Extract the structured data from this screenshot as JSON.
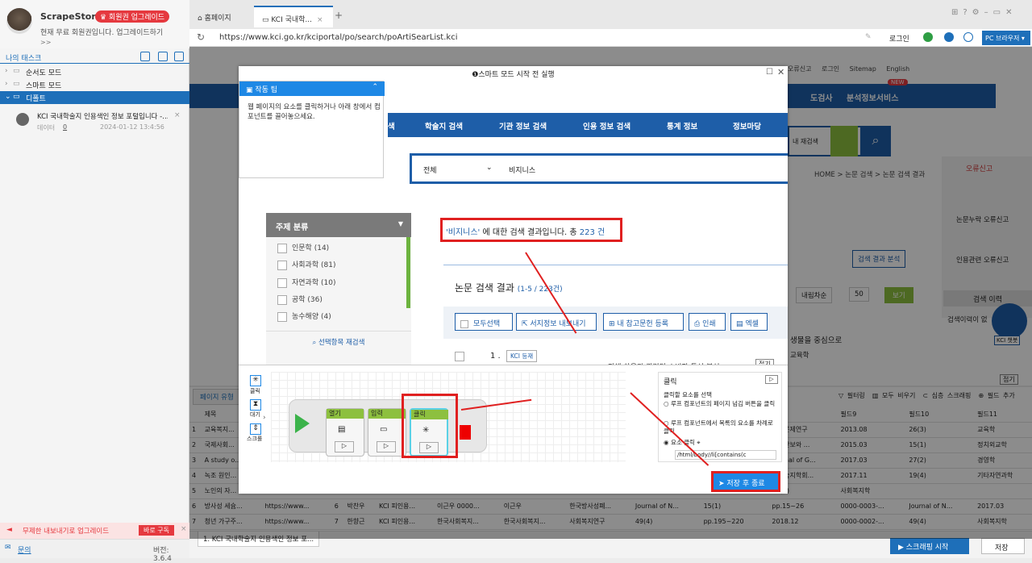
{
  "sidebar": {
    "app_name": "ScrapeStorm",
    "upgrade_badge": "♛ 회원권 업그레이드",
    "free_note": "현재 무료 회원권입니다. 업그레이드하기",
    "more": ">>",
    "tasks_title": "나의 태스크",
    "tree": [
      "순서도 모드",
      "스마트 모드",
      "디폴트"
    ],
    "task": {
      "name": "KCI 국내학술지 인용색인 정보 포털입니다 -...",
      "meta": "데이터",
      "count": "0",
      "date": "2024-01-12 13:4:56"
    },
    "bottom_ad": "무제한 내보내기로 업그레이드",
    "bottom_ad_btn": "바로 구독",
    "help": "문의",
    "version": "버전: 3.6.4"
  },
  "browser": {
    "tabs": [
      "홈페이지",
      "KCI 국내학..."
    ],
    "url": "https://www.kci.go.kr/kciportal/po/search/poArtiSearList.kci",
    "login": "로그인",
    "pc_browser": "PC 브라우저 ▾"
  },
  "webpage": {
    "top_links": [
      "오류신고",
      "로그인",
      "Sitemap",
      "English"
    ],
    "nav_right": [
      "도검사",
      "분석정보서비스"
    ],
    "new_badge": "NEW",
    "search_right": "내 재검색",
    "breadcrumb": "HOME > 논문 검색 > 논문 검색 결과",
    "side_report": "오류신고",
    "side_items": [
      "논문누락 오류신고",
      "인용관련 오류신고"
    ],
    "analysis_btn": "검색 결과 분석",
    "sort": "내림차순",
    "per_page": "50",
    "view_btn": "보기",
    "history_title": "검색 이력",
    "history_note": "검색이력이 없",
    "chatbot": "KCI 챗봇",
    "snippet1": "생물을 중심으로",
    "snippet2": "교육학",
    "collapse": "접기"
  },
  "modal": {
    "title": "스마트 모드 시작 전 실행",
    "tip_title": "작동 팁",
    "tip_body": "웹 페이지의 요소를 클릭하거나 아래 창에서 컴포넌트를 끌어놓으세요.",
    "nav": [
      "학술지 검색",
      "기관 정보 검색",
      "인용 정보 검색",
      "통계 정보",
      "정보마당"
    ],
    "search_scope": "전체",
    "search_query": "비지니스",
    "filter_title": "주제 분류",
    "filters": [
      "인문학 (14)",
      "사회과학 (81)",
      "자연과학 (10)",
      "공학 (36)",
      "농수해양 (4)"
    ],
    "filter_btn": "선택항목 재검색",
    "result_quote": "'비지니스'",
    "result_mid": " 에 대한 검색 결과입니다. 총 ",
    "result_count": "223 건",
    "result_title": "논문 검색 결과",
    "result_range": "(1-5 / 223건)",
    "buttons": [
      "모두선택",
      "서지정보 내보내기",
      "내 참고문헌 등록",
      "인쇄",
      "엑셀"
    ],
    "item_num": "1 .",
    "kci_badge": "KCI 등재",
    "item_snippet": "자체 차용과 관련된 소비자 특성 분석",
    "collapse": "접기",
    "side_tools": [
      "클릭",
      "대기",
      "스크롤"
    ],
    "nodes": [
      "열기",
      "입력",
      "클릭"
    ],
    "config_title": "클릭",
    "config_sub": "클릭할 요소를 선택",
    "config_opts": [
      "루프 컴포넌트의 페이지 넘김 버튼을 클릭",
      "루프 컴포넌트에서 목록의 요소를 차례로 클릭",
      "요소 클릭"
    ],
    "xpath": "/html/body//li[contains(c",
    "save_exit": "저장 후 종료"
  },
  "datapanel": {
    "tab": "페이지 유형",
    "tools": [
      "필터링",
      "모두 비우기",
      "심층 스크래핑",
      "필드 추가"
    ],
    "headers": [
      "",
      "제목",
      "",
      "",
      "",
      "",
      "",
      "",
      "",
      "",
      "blind1",
      "필드8",
      "필드9",
      "필드10",
      "필드11"
    ],
    "rows": [
      [
        "1",
        "교육복지...",
        "",
        "",
        "",
        "",
        "",
        "",
        "",
        "",
        "0000-0002-...",
        "교육문제연구",
        "2013.08",
        "26(3)",
        "교육학"
      ],
      [
        "2",
        "국제사회...",
        "",
        "",
        "",
        "",
        "",
        "",
        "",
        "",
        "0000-0002-...",
        "국가안보와 ...",
        "2015.03",
        "15(1)",
        "정치외교학"
      ],
      [
        "3",
        "A study o...",
        "",
        "",
        "",
        "",
        "",
        "",
        "",
        "",
        "0000-0002-...",
        "Journal of G...",
        "2017.03",
        "27(2)",
        "경영학"
      ],
      [
        "4",
        "녹조 원인...",
        "",
        "",
        "",
        "",
        "",
        "",
        "",
        "",
        "0000-0002-...",
        "한국습지학회...",
        "2017.11",
        "19(4)",
        "기타자연과학"
      ],
      [
        "5",
        "노인의 자...",
        "",
        "",
        "",
        "",
        "",
        "",
        "",
        "",
        "0000-0002-...",
        "37(2)",
        "사회복지학",
        "",
        ""
      ],
      [
        "6",
        "방사성 세슘...",
        "https://www...",
        "6",
        "박찬우",
        "KCI 피인용...",
        "이근우 0000...",
        "이근우",
        "한국방사성폐...",
        "Journal of N...",
        "15(1)",
        "pp.15~26",
        "0000-0003-...",
        "Journal of N...",
        "2017.03"
      ],
      [
        "7",
        "청년 가구주...",
        "https://www...",
        "7",
        "한향근",
        "KCI 피인용...",
        "한국사회복지...",
        "한국사회복지...",
        "사회복지연구",
        "49(4)",
        "pp.195~220",
        "2018.12",
        "0000-0002-...",
        "49(4)",
        "사회복지학"
      ]
    ],
    "extra_col": "원자력공학",
    "footer_task": "1. KCI 국내학술지 인용색인 정보 포...",
    "start_btn": "▶ 스크래핑 시작",
    "save_btn": "저장"
  },
  "colors": {
    "accent": "#1e6fb9",
    "kci_nav": "#1e5ea8",
    "highlight": "#e02020",
    "node_green": "#8dc03f"
  }
}
